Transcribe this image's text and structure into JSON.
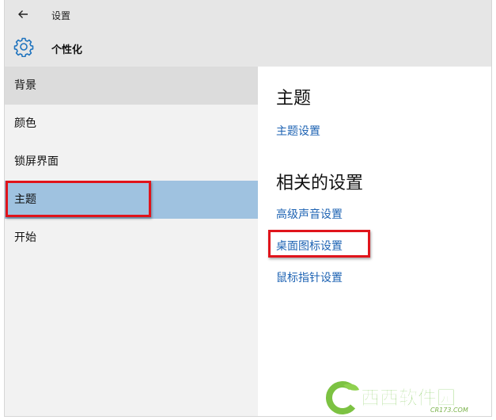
{
  "window": {
    "app_title": "设置",
    "page_title": "个性化"
  },
  "sidebar": {
    "items": [
      {
        "label": "背景",
        "state": "hover"
      },
      {
        "label": "颜色",
        "state": "normal"
      },
      {
        "label": "锁屏界面",
        "state": "normal"
      },
      {
        "label": "主题",
        "state": "selected"
      },
      {
        "label": "开始",
        "state": "normal"
      }
    ]
  },
  "main": {
    "theme_heading": "主题",
    "theme_settings_link": "主题设置",
    "related_heading": "相关的设置",
    "related_links": [
      "高级声音设置",
      "桌面图标设置",
      "鼠标指针设置"
    ]
  },
  "watermark": {
    "text": "西西软件园",
    "url_text": "CR173.COM"
  },
  "colors": {
    "titlebar": "#e6e6e6",
    "sidebar": "#f2f2f2",
    "selected": "#9fc2e0",
    "link": "#1e63b3",
    "highlight": "#e0141b",
    "accent": "#1e73be"
  },
  "icons": {
    "back": "back-arrow-icon",
    "page": "gear-icon"
  }
}
